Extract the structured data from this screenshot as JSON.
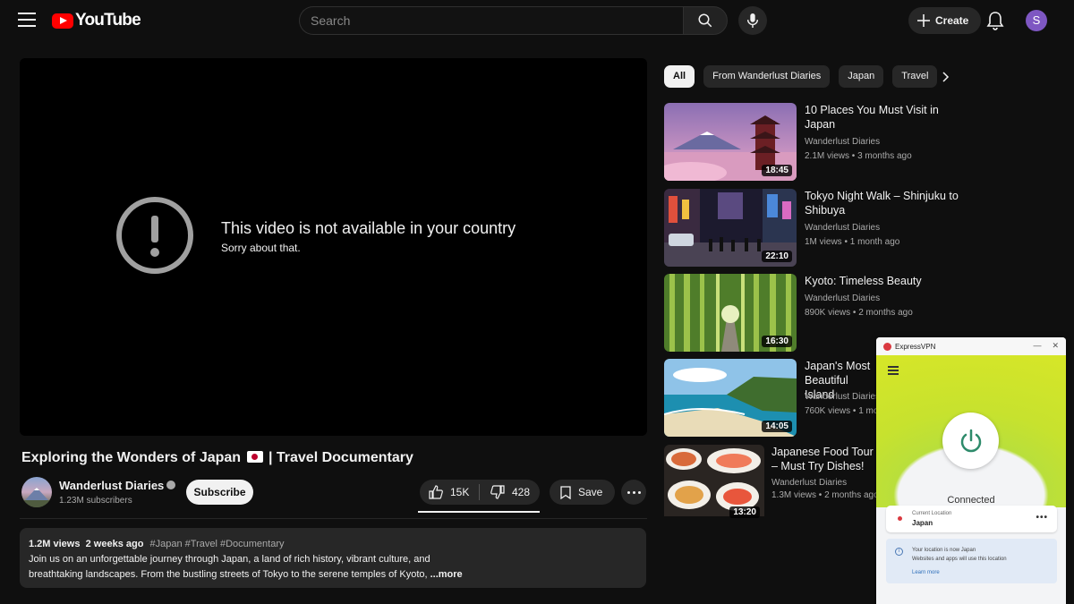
{
  "topbar": {
    "logo_text": "YouTube",
    "search_placeholder": "Search",
    "create_label": "Create",
    "avatar_letter": "S"
  },
  "player": {
    "error_title": "This video is not available in your country",
    "error_subtitle": "Sorry about that."
  },
  "video": {
    "title_before_flag": "Exploring the Wonders of Japan",
    "title_after_flag": "| Travel Documentary",
    "channel_name": "Wanderlust Diaries",
    "subscribers": "1.23M subscribers",
    "subscribe_label": "Subscribe",
    "likes": "15K",
    "dislikes": "428",
    "save_label": "Save"
  },
  "description": {
    "views": "1.2M views",
    "date": "2 weeks ago",
    "tags": "#Japan #Travel #Documentary",
    "line1": "Join us on an unforgettable journey through Japan, a land of rich history, vibrant culture, and",
    "line2": "breathtaking landscapes. From the bustling streets of Tokyo to the serene temples of Kyoto,",
    "more": "...more"
  },
  "chips": [
    "All",
    "From Wanderlust Diaries",
    "Japan",
    "Travel"
  ],
  "recommendations": [
    {
      "title": "10 Places You Must Visit in Japan",
      "channel": "Wanderlust Diaries",
      "meta": "2.1M views • 3 months ago",
      "duration": "18:45"
    },
    {
      "title": "Tokyo Night Walk – Shinjuku to Shibuya",
      "channel": "Wanderlust Diaries",
      "meta": "1M views • 1 month ago",
      "duration": "22:10"
    },
    {
      "title": "Kyoto: Timeless Beauty",
      "channel": "Wanderlust Diaries",
      "meta": "890K views • 2 months ago",
      "duration": "16:30"
    },
    {
      "title": "Japan's Most Beautiful Island",
      "channel": "Wanderlust Diaries",
      "meta": "760K views • 1 mo",
      "duration": "14:05"
    },
    {
      "title": "Japanese Food Tour – Must Try Dishes!",
      "channel": "Wanderlust Diaries",
      "meta": "1.3M views • 2 months ago",
      "duration": "13:20"
    }
  ],
  "vpn": {
    "app_name": "ExpressVPN",
    "status": "Connected",
    "location_label": "Current Location",
    "location_value": "Japan",
    "info_line1": "Your location is now Japan",
    "info_line2": "Websites and apps will use this location",
    "info_link": "Learn more"
  },
  "colors": {
    "youtube_red": "#ff0000",
    "background": "#0f0f0f",
    "vpn_green": "#c7e22e",
    "vpn_red": "#da3940"
  }
}
